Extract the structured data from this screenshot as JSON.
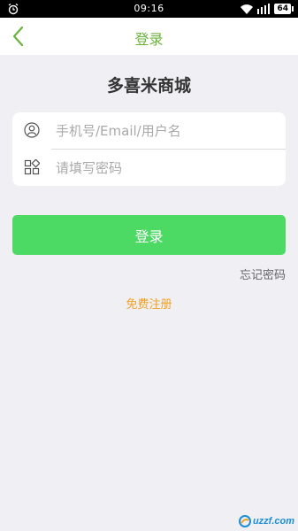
{
  "status_bar": {
    "time": "09:16",
    "battery": "64",
    "icons": [
      "alarm-icon",
      "wifi-icon",
      "signal-icon",
      "battery-icon"
    ]
  },
  "nav": {
    "title": "登录",
    "back_icon": "chevron-left-icon"
  },
  "shop_title": "多喜米商城",
  "form": {
    "username_placeholder": "手机号/Email/用户名",
    "username_icon": "user-icon",
    "password_placeholder": "请填写密码",
    "password_icon": "grid-icon"
  },
  "login_button_label": "登录",
  "forgot_password_label": "忘记密码",
  "register_label": "免费注册",
  "watermark": "uzzf.com",
  "colors": {
    "accent_green": "#6cb33e",
    "button_green": "#4cd964",
    "register_orange": "#f0a020",
    "background": "#efeff4"
  }
}
